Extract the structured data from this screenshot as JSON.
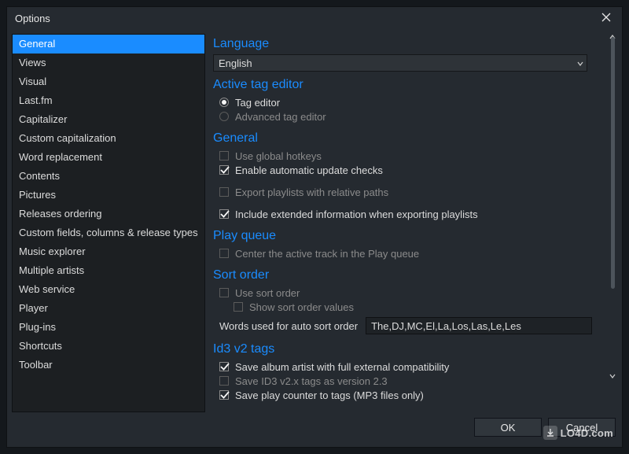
{
  "window": {
    "title": "Options"
  },
  "sidebar": {
    "selected_index": 0,
    "items": [
      "General",
      "Views",
      "Visual",
      "Last.fm",
      "Capitalizer",
      "Custom capitalization",
      "Word replacement",
      "Contents",
      "Pictures",
      "Releases ordering",
      "Custom fields, columns & release types",
      "Music explorer",
      "Multiple artists",
      "Web service",
      "Player",
      "Plug-ins",
      "Shortcuts",
      "Toolbar"
    ]
  },
  "sections": {
    "language": {
      "heading": "Language",
      "value": "English"
    },
    "active_tag_editor": {
      "heading": "Active tag editor",
      "radios": {
        "tag_editor": {
          "label": "Tag editor",
          "checked": true
        },
        "advanced": {
          "label": "Advanced tag editor",
          "checked": false
        }
      }
    },
    "general": {
      "heading": "General",
      "use_global_hotkeys": {
        "label": "Use global hotkeys",
        "checked": false
      },
      "enable_updates": {
        "label": "Enable automatic update checks",
        "checked": true
      },
      "export_relative": {
        "label": "Export playlists with relative paths",
        "checked": false
      },
      "include_extended": {
        "label": "Include extended information when exporting playlists",
        "checked": true
      }
    },
    "play_queue": {
      "heading": "Play queue",
      "center_active": {
        "label": "Center the active track in the Play queue",
        "checked": false
      }
    },
    "sort_order": {
      "heading": "Sort order",
      "use_sort_order": {
        "label": "Use sort order",
        "checked": false
      },
      "show_values": {
        "label": "Show sort order values",
        "checked": false
      },
      "words_label": "Words used for auto sort order",
      "words_value": "The,DJ,MC,El,La,Los,Las,Le,Les"
    },
    "id3": {
      "heading": "Id3 v2 tags",
      "save_album_artist": {
        "label": "Save album artist with full external compatibility",
        "checked": true
      },
      "save_v23": {
        "label": "Save ID3 v2.x tags as version 2.3",
        "checked": false
      },
      "save_play_counter": {
        "label": "Save play counter to tags (MP3 files only)",
        "checked": true
      }
    }
  },
  "footer": {
    "ok": "OK",
    "cancel": "Cancel"
  },
  "watermark": "LO4D.com"
}
